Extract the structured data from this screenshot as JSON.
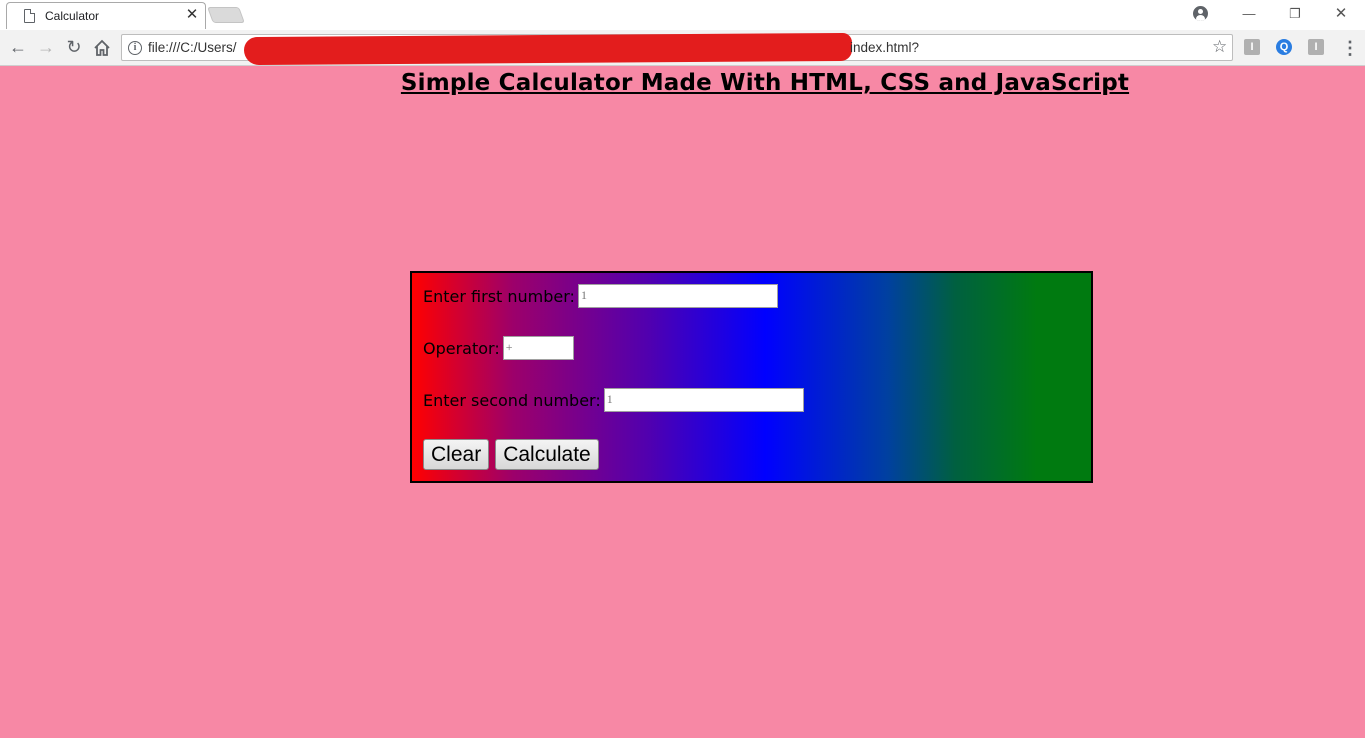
{
  "browser": {
    "tab_title": "Calculator",
    "tab_close": "✕",
    "address": {
      "url_start": "file:///C:/Users/",
      "url_end": "index.html?"
    },
    "window_controls": {
      "minimize": "—",
      "restore": "❐",
      "close": "✕"
    },
    "extensions": [
      {
        "icon": "extension-icon",
        "color": "#b0b0b0",
        "glyph": "I"
      },
      {
        "icon": "search-extension-icon",
        "color": "#2a7de1",
        "glyph": "Q"
      },
      {
        "icon": "extension-icon",
        "color": "#b0b0b0",
        "glyph": "I"
      }
    ]
  },
  "page": {
    "background": "#f788a5",
    "heading": "Simple Calculator Made With HTML, CSS and JavaScript",
    "form": {
      "first_label": "Enter first number:",
      "first_value": "1",
      "operator_label": "Operator:",
      "operator_value": "+",
      "second_label": "Enter second number:",
      "second_value": "1",
      "clear_button": "Clear",
      "calculate_button": "Calculate"
    },
    "gradient_colors": [
      "#ff0000",
      "#0000ff",
      "#007a10"
    ]
  }
}
